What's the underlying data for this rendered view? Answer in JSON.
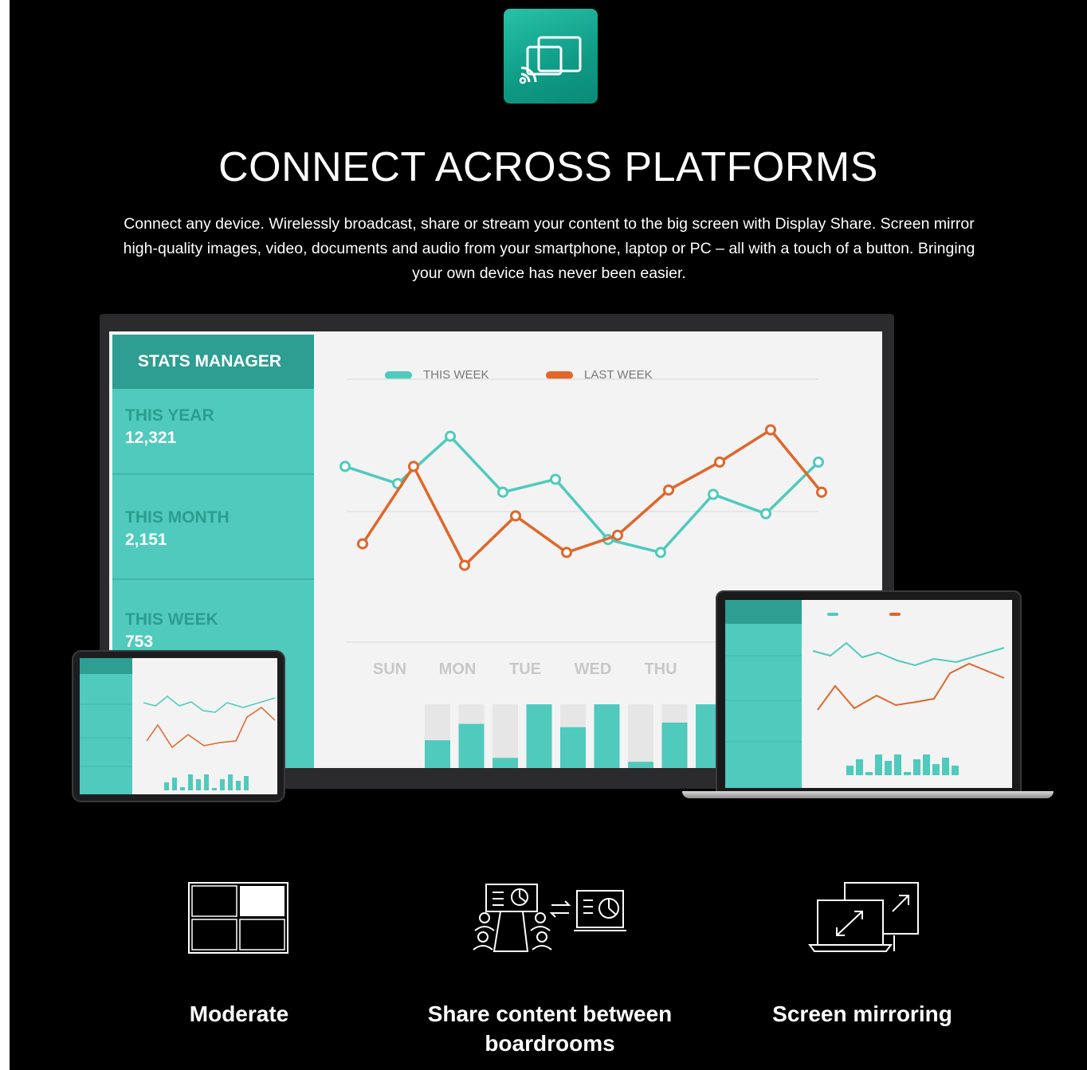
{
  "headline": "CONNECT ACROSS PLATFORMS",
  "intro_lines": [
    "Connect any device. Wirelessly broadcast, share or stream your content to the big screen with Display Share. Screen mirror",
    "high-quality images, video, documents and audio from your smartphone, laptop or PC – all with a touch of a button. Bringing",
    "your own device has never been easier."
  ],
  "app_icon": "screen-cast-icon",
  "colors": {
    "accent": "#1db39d",
    "this_week": "#4fcabd",
    "last_week": "#e0662a",
    "sidebar": "#4fcabd",
    "sidebar_head": "#2e9e92"
  },
  "dashboard": {
    "title": "STATS MANAGER",
    "stats": [
      {
        "label": "THIS YEAR",
        "value": "12,321"
      },
      {
        "label": "THIS MONTH",
        "value": "2,151"
      },
      {
        "label": "THIS WEEK",
        "value": "753"
      }
    ],
    "legend": {
      "this_week": "THIS WEEK",
      "last_week": "LAST WEEK"
    },
    "days": [
      "SUN",
      "MON",
      "TUE",
      "WED",
      "THU"
    ]
  },
  "chart_data": {
    "type": "line",
    "series": [
      {
        "name": "THIS WEEK",
        "values": [
          0.78,
          0.7,
          0.92,
          0.66,
          0.72,
          0.44,
          0.38,
          0.65,
          0.56,
          0.8
        ]
      },
      {
        "name": "LAST WEEK",
        "values": [
          0.42,
          0.78,
          0.32,
          0.55,
          0.38,
          0.46,
          0.67,
          0.8,
          0.95,
          0.66
        ]
      }
    ],
    "bars": [
      0.45,
      0.7,
      0.18,
      1.0,
      0.65,
      1.0,
      0.12,
      0.72,
      1.0
    ]
  },
  "features": [
    {
      "title_lines": [
        "Moderate"
      ],
      "icon": "quad-split-screen-icon"
    },
    {
      "title_lines": [
        "Share content between",
        "boardrooms"
      ],
      "icon": "boardroom-share-icon"
    },
    {
      "title_lines": [
        "Screen mirroring"
      ],
      "icon": "screen-mirroring-icon"
    }
  ]
}
